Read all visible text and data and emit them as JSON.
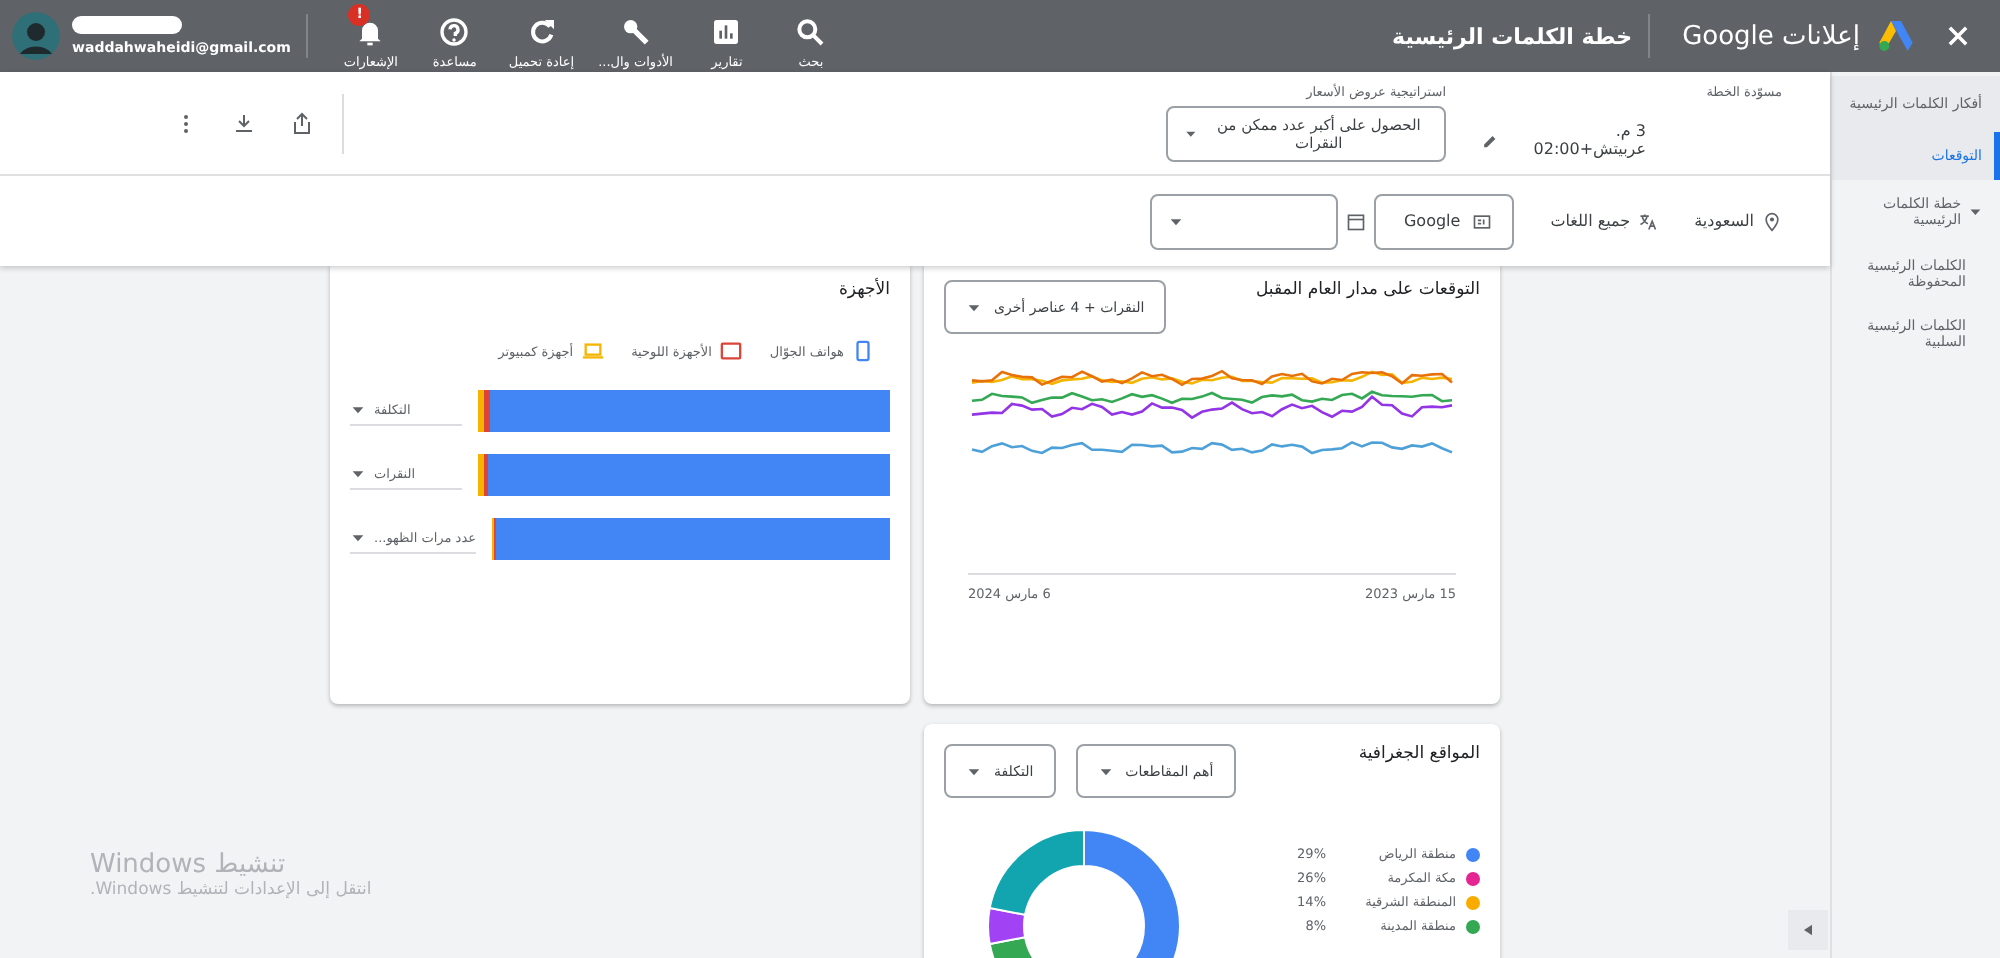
{
  "top_bar": {
    "brand": "إعلانات Google",
    "title": "خطة الكلمات الرئيسية",
    "nav": [
      {
        "kind": "search",
        "label": "بحث"
      },
      {
        "kind": "reports",
        "label": "تقارير"
      },
      {
        "kind": "tools",
        "label": "الأدوات وال..."
      },
      {
        "kind": "refresh",
        "label": "إعادة تحميل"
      },
      {
        "kind": "help",
        "label": "مساعدة"
      },
      {
        "kind": "notifications",
        "label": "الإشعارات",
        "badge": "!"
      }
    ],
    "account": {
      "email": "waddahwaheidi@gmail.com"
    }
  },
  "sidebar": {
    "items": [
      {
        "label": "أفكار الكلمات الرئيسية",
        "selected": false
      },
      {
        "label": "التوقعات",
        "selected": true
      },
      {
        "label": "خطة الكلمات الرئيسية",
        "selected": false,
        "expanded": true,
        "children": [
          {
            "label": "الكلمات الرئيسية المحفوظة",
            "selected": false
          },
          {
            "label": "الكلمات الرئيسية السلبية",
            "selected": false
          }
        ]
      }
    ]
  },
  "plan": {
    "draft_label": "مسوّدة الخطة",
    "draft_value": "3 م. عربيتش+02:00",
    "bid_strategy_label": "استراتيجية عروض الأسعار",
    "bid_strategy_value": "الحصول على أكبر عدد ممكن من النقرات"
  },
  "filters": {
    "location": "السعودية",
    "language": "جميع اللغات",
    "network": "Google"
  },
  "forecast": {
    "title": "التوقعات على مدار العام المقبل",
    "metric": "النقرات + 4 عناصر أخرى",
    "x_labels": [
      "15 مارس 2023",
      "6 مارس 2024"
    ]
  },
  "devices": {
    "title": "الأجهزة",
    "legend": [
      {
        "kind": "phone",
        "label": "هواتف الجوّال",
        "color": "#4285f4"
      },
      {
        "kind": "tablet",
        "label": "الأجهزة اللوحية",
        "color": "#db4437"
      },
      {
        "kind": "computer",
        "label": "أجهزة كمبيوتر",
        "color": "#f4b400"
      }
    ],
    "bars": [
      {
        "metric": "التكلفة",
        "level": 0.97
      },
      {
        "metric": "النقرات",
        "level": 0.975
      },
      {
        "metric": "عدد مرات الظهو...",
        "level": 0.99
      }
    ]
  },
  "geo": {
    "title": "المواقع الجغرافية",
    "dropdowns": [
      "أهم المقاطعات",
      "التكلفة"
    ],
    "locations": [
      {
        "name": "منطقة الرياض",
        "share": "29%",
        "color": "#4285f4"
      },
      {
        "name": "مكة المكرمة",
        "share": "26%",
        "color": "#e52592"
      },
      {
        "name": "المنطقة الشرقية",
        "share": "14%",
        "color": "#f9ab00"
      },
      {
        "name": "منطقة المدينة",
        "share": "8%",
        "color": "#34a853"
      }
    ]
  },
  "os_notice": {
    "title": "تنشيط Windows",
    "subtitle": "انتقل إلى الإعدادات لتنشيط Windows."
  }
}
